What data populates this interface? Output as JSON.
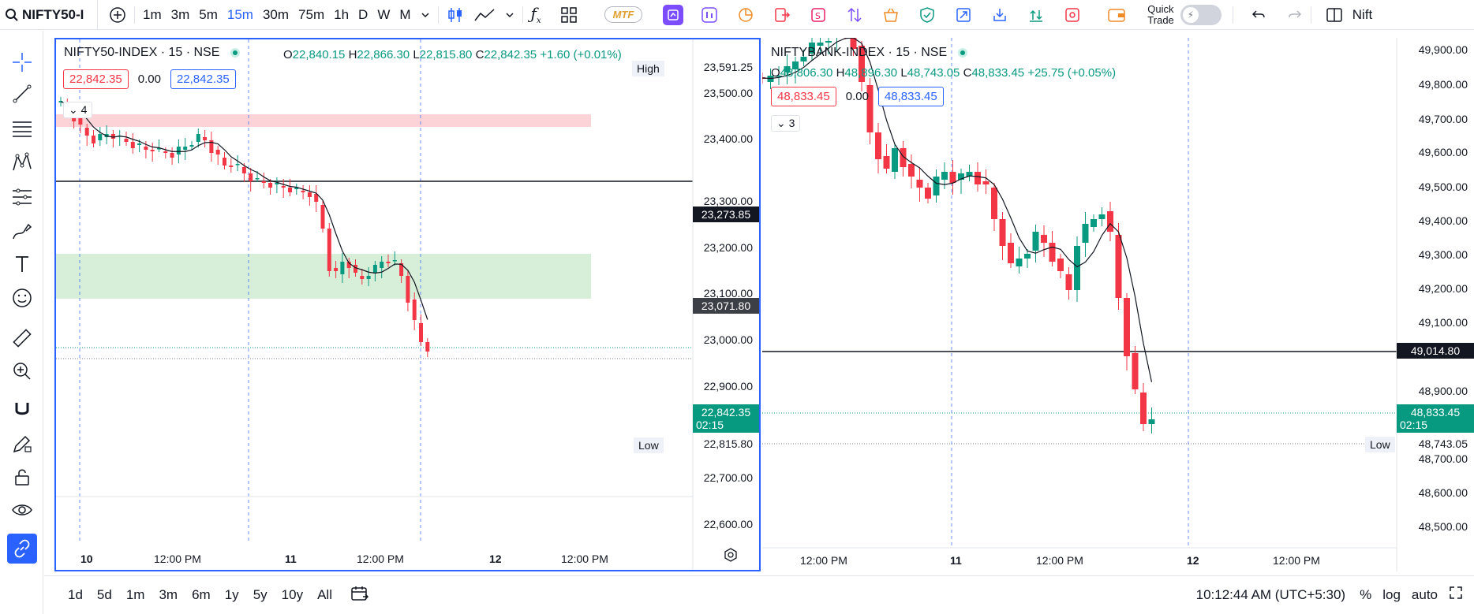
{
  "toolbar": {
    "symbol": "NIFTY50-I",
    "intervals": [
      "1m",
      "3m",
      "5m",
      "15m",
      "30m",
      "75m",
      "1h",
      "D",
      "W",
      "M"
    ],
    "active_interval": "15m",
    "mtf_label": "MTF",
    "quick_trade_line1": "Quick",
    "quick_trade_line2": "Trade",
    "right_symbol": "Nift"
  },
  "left_chart": {
    "title": "NIFTY50-INDEX · 15 · NSE",
    "ohlc": {
      "o_label": "O",
      "o": "22,840.15",
      "h_label": "H",
      "h": "22,866.30",
      "l_label": "L",
      "l": "22,815.80",
      "c_label": "C",
      "c": "22,842.35",
      "change": "+1.60 (+0.01%)"
    },
    "sell_price": "22,842.35",
    "spread": "0.00",
    "buy_price": "22,842.35",
    "collapse_count": "4",
    "high_label": "High",
    "high_value": "23,591.25",
    "low_label": "Low",
    "low_value": "22,815.80",
    "price_labels": [
      "23,500.00",
      "23,400.00",
      "23,300.00",
      "23,200.00",
      "23,100.00",
      "23,000.00",
      "22,900.00",
      "22,700.00",
      "22,600.00"
    ],
    "hline_1": "23,273.85",
    "hline_2": "23,071.80",
    "last_price": "22,842.35",
    "countdown": "02:15",
    "time_labels": [
      "10",
      "12:00 PM",
      "11",
      "12:00 PM",
      "12",
      "12:00 PM"
    ]
  },
  "right_chart": {
    "title": "NIFTYBANK-INDEX · 15 · NSE",
    "ohlc": {
      "o_label": "O",
      "o": "48,806.30",
      "h_label": "H",
      "h": "48,896.30",
      "l_label": "L",
      "l": "48,743.05",
      "c_label": "C",
      "c": "48,833.45",
      "change": "+25.75 (+0.05%)"
    },
    "sell_price": "48,833.45",
    "spread": "0.00",
    "buy_price": "48,833.45",
    "collapse_count": "3",
    "price_labels": [
      "49,900.00",
      "49,800.00",
      "49,700.00",
      "49,600.00",
      "49,500.00",
      "49,400.00",
      "49,300.00",
      "49,200.00",
      "49,100.00",
      "48,900.00",
      "48,700.00",
      "48,600.00",
      "48,500.00"
    ],
    "hline": "49,014.80",
    "last_price": "48,833.45",
    "countdown": "02:15",
    "low_label": "Low",
    "low_value": "48,743.05",
    "time_labels": [
      "12:00 PM",
      "11",
      "12:00 PM",
      "12",
      "12:00 PM"
    ]
  },
  "bottom": {
    "ranges": [
      "1d",
      "5d",
      "1m",
      "3m",
      "6m",
      "1y",
      "5y",
      "10y",
      "All"
    ],
    "clock": "10:12:44 AM (UTC+5:30)",
    "percent": "%",
    "log": "log",
    "auto": "auto"
  },
  "colors": {
    "up": "#089981",
    "down": "#f23645",
    "accent": "#2962ff",
    "resistance_zone": "#fcd3d6",
    "support_zone": "#d7eed9"
  }
}
